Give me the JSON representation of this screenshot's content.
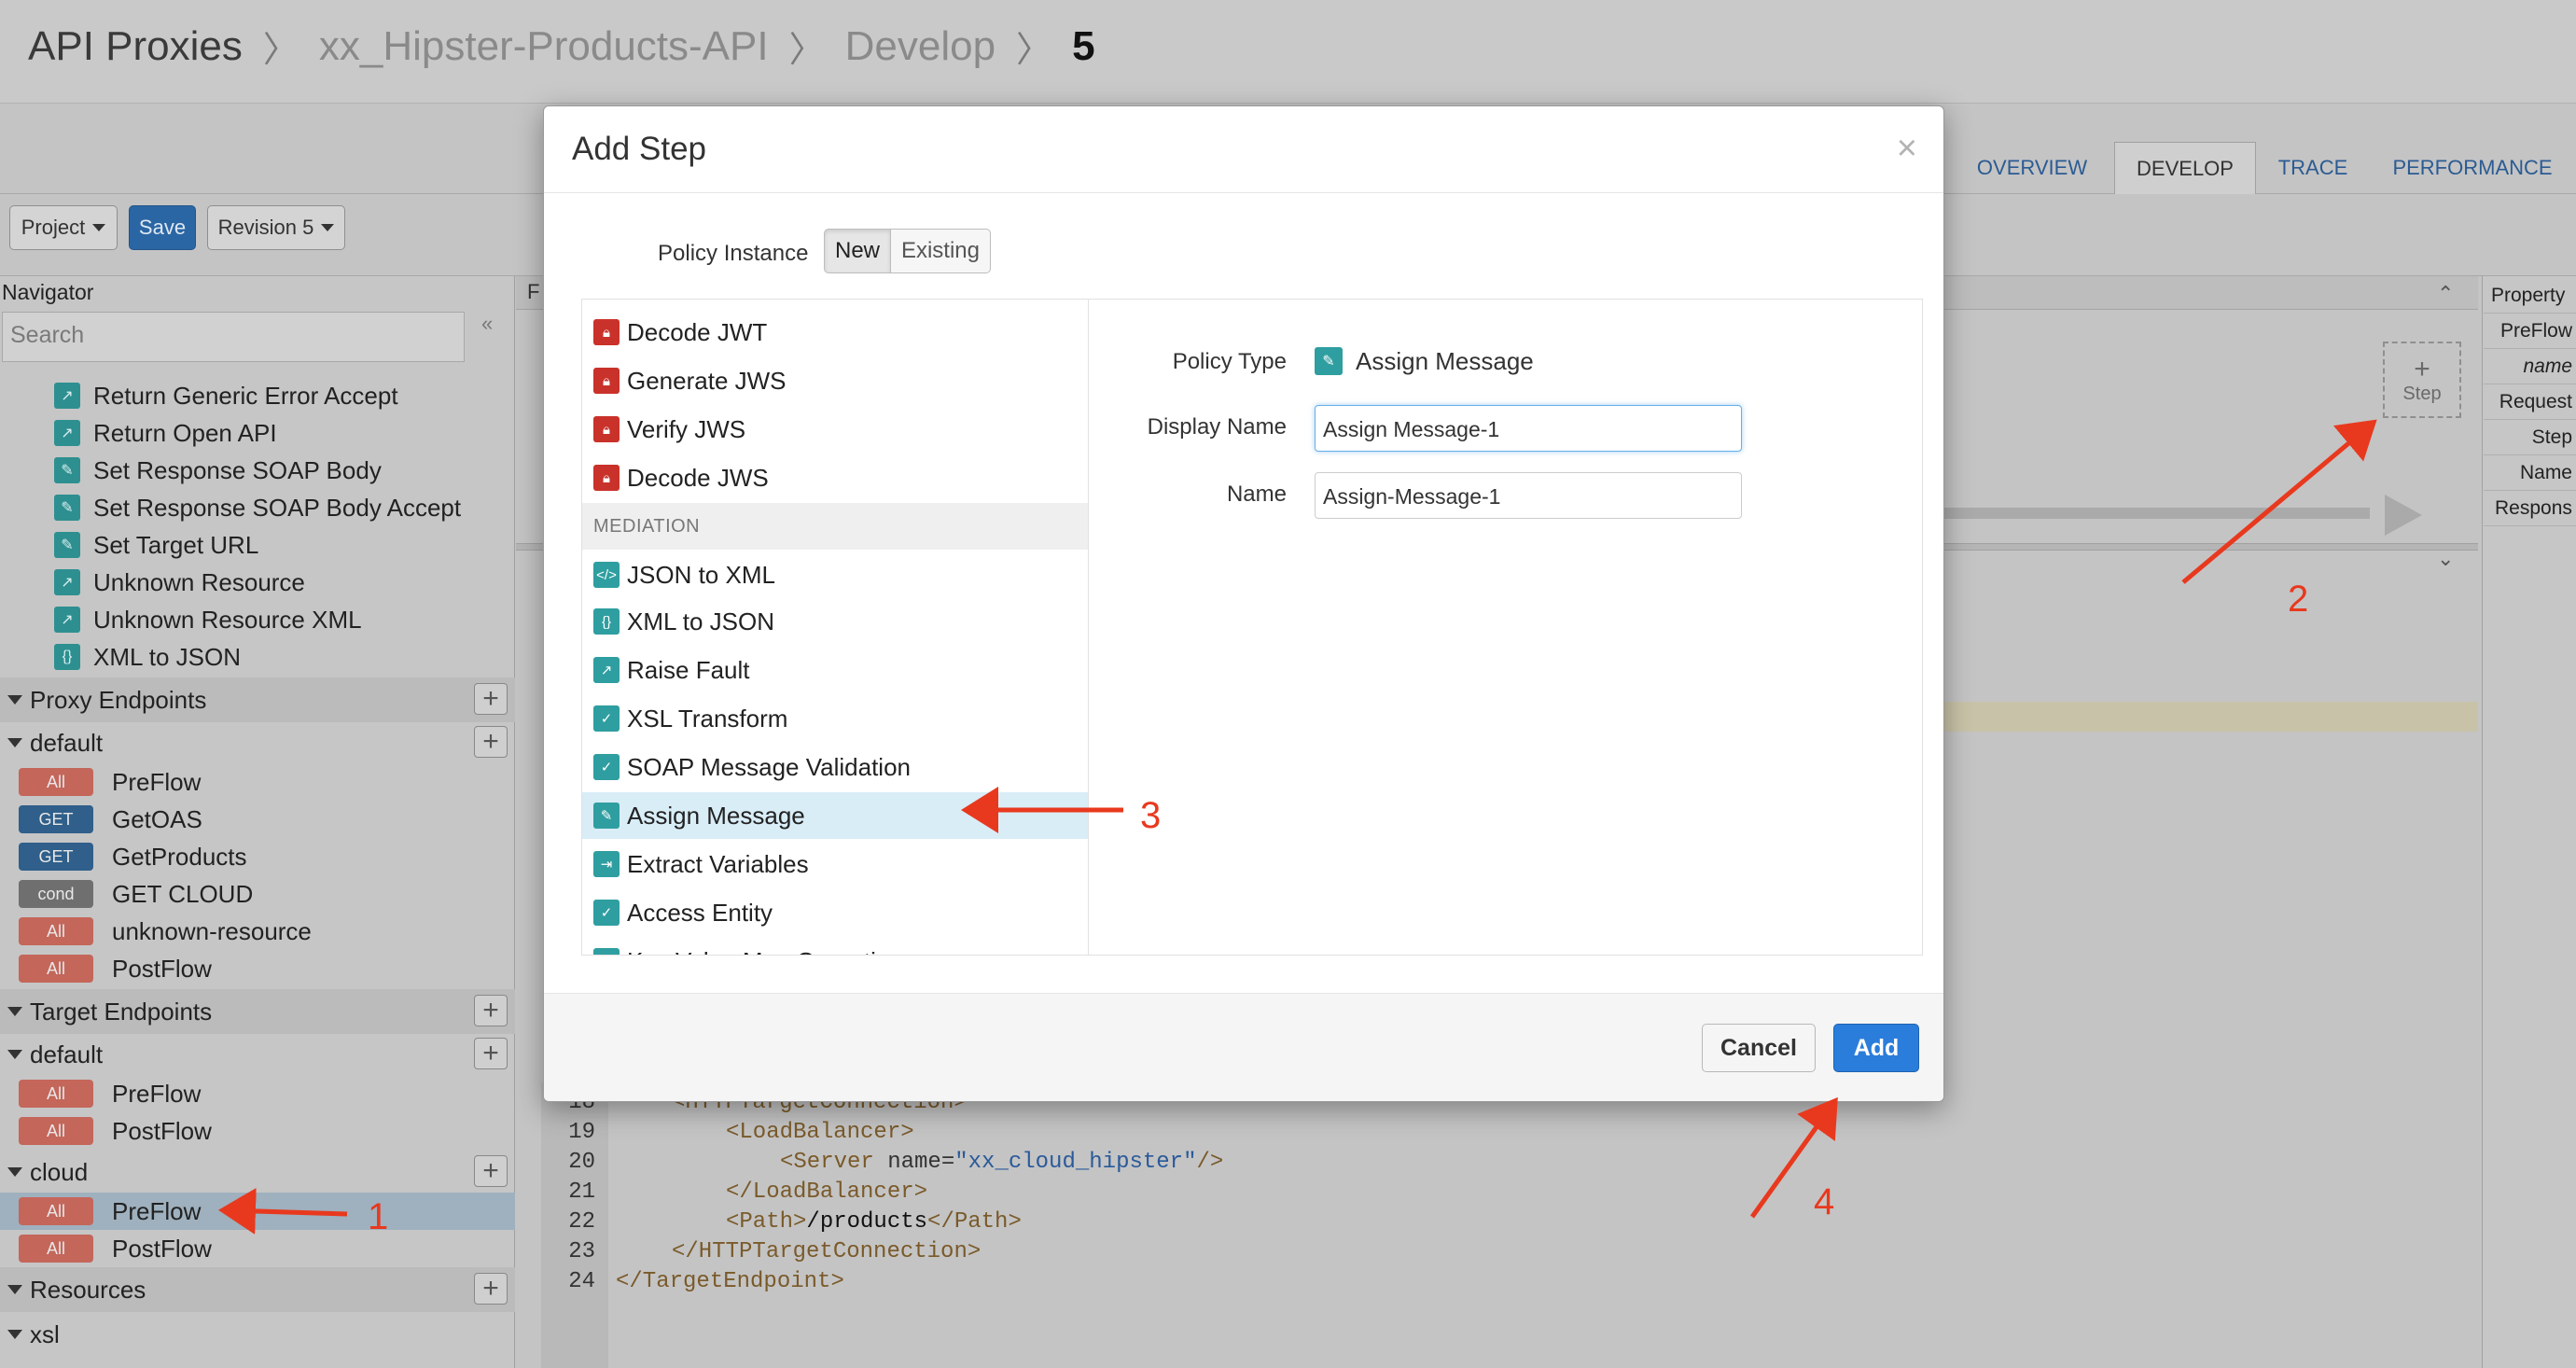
{
  "breadcrumb": {
    "root": "API Proxies",
    "proxy": "xx_Hipster-Products-API",
    "section": "Develop",
    "revision": "5"
  },
  "tabs": [
    {
      "label": "OVERVIEW"
    },
    {
      "label": "DEVELOP"
    },
    {
      "label": "TRACE"
    },
    {
      "label": "PERFORMANCE"
    }
  ],
  "toolbar": {
    "project_label": "Project",
    "save_label": "Save",
    "revision_label": "Revision 5"
  },
  "navigator": {
    "title": "Navigator",
    "search_placeholder": "Search",
    "policies": [
      "Return Generic Error Accept",
      "Return Open API",
      "Set Response SOAP Body",
      "Set Response SOAP Body Accept",
      "Set Target URL",
      "Unknown Resource",
      "Unknown Resource XML",
      "XML to JSON"
    ],
    "proxy_endpoints": {
      "label": "Proxy Endpoints",
      "default_label": "default",
      "flows": [
        {
          "badge": "All",
          "name": "PreFlow"
        },
        {
          "badge": "GET",
          "name": "GetOAS"
        },
        {
          "badge": "GET",
          "name": "GetProducts"
        },
        {
          "badge": "cond",
          "name": "GET CLOUD"
        },
        {
          "badge": "All",
          "name": "unknown-resource"
        },
        {
          "badge": "All",
          "name": "PostFlow"
        }
      ]
    },
    "target_endpoints": {
      "label": "Target Endpoints",
      "default_label": "default",
      "default_flows": [
        {
          "badge": "All",
          "name": "PreFlow"
        },
        {
          "badge": "All",
          "name": "PostFlow"
        }
      ],
      "cloud_label": "cloud",
      "cloud_flows": [
        {
          "badge": "All",
          "name": "PreFlow"
        },
        {
          "badge": "All",
          "name": "PostFlow"
        }
      ]
    },
    "resources_label": "Resources",
    "xsl_label": "xsl"
  },
  "center": {
    "panel_initial": "F",
    "step_plus": "+",
    "step_label": "Step"
  },
  "code": {
    "lines": [
      {
        "num": "18",
        "text": "<HTTPTargetConnection>"
      },
      {
        "num": "19",
        "text": "<LoadBalancer>"
      },
      {
        "num": "20",
        "tag": "<Server ",
        "attr": "name=",
        "str": "\"xx_cloud_hipster\"",
        "end": "/>"
      },
      {
        "num": "21",
        "text": "</LoadBalancer>"
      },
      {
        "num": "22",
        "tag": "<Path>",
        "txt": "/products",
        "end": "</Path>"
      },
      {
        "num": "23",
        "text": "</HTTPTargetConnection>"
      },
      {
        "num": "24",
        "text": "</TargetEndpoint>"
      }
    ]
  },
  "properties": {
    "title": "Property",
    "rows": [
      "PreFlow",
      "name",
      "Request",
      "Step",
      "Name",
      "Respons"
    ]
  },
  "modal": {
    "title": "Add Step",
    "close": "×",
    "policy_instance_label": "Policy Instance",
    "seg_new": "New",
    "seg_existing": "Existing",
    "policy_list": [
      {
        "label": "Decode JWT",
        "icon": "lock-icon"
      },
      {
        "label": "Generate JWS",
        "icon": "lock-icon"
      },
      {
        "label": "Verify JWS",
        "icon": "lock-icon"
      },
      {
        "label": "Decode JWS",
        "icon": "lock-icon"
      },
      {
        "group": "MEDIATION"
      },
      {
        "label": "JSON to XML",
        "icon": "code-icon"
      },
      {
        "label": "XML to JSON",
        "icon": "braces-icon"
      },
      {
        "label": "Raise Fault",
        "icon": "fault-icon"
      },
      {
        "label": "XSL Transform",
        "icon": "transform-icon"
      },
      {
        "label": "SOAP Message Validation",
        "icon": "check-icon"
      },
      {
        "label": "Assign Message",
        "icon": "pencil-icon",
        "selected": true
      },
      {
        "label": "Extract Variables",
        "icon": "extract-icon"
      },
      {
        "label": "Access Entity",
        "icon": "check-icon"
      },
      {
        "label": "Key Value Map Operations",
        "icon": "kvm-icon"
      }
    ],
    "policy_type_label": "Policy Type",
    "policy_type_value": "Assign Message",
    "display_name_label": "Display Name",
    "display_name_value": "Assign Message-1",
    "name_label": "Name",
    "name_value": "Assign-Message-1",
    "cancel_label": "Cancel",
    "add_label": "Add"
  },
  "annotations": {
    "n1": "1",
    "n2": "2",
    "n3": "3",
    "n4": "4",
    "color": "#e8391e"
  }
}
